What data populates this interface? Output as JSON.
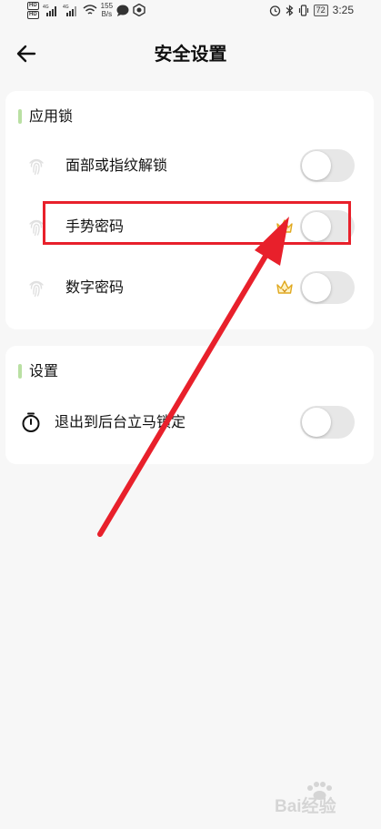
{
  "status_bar": {
    "hd_top": "HD",
    "hd_bottom": "HD",
    "net_type_1": "4G",
    "net_type_2": "4G",
    "speed_value": "155",
    "speed_unit": "B/s",
    "battery_level": "72",
    "time": "3:25",
    "icons": [
      "wifi-icon",
      "message-icon",
      "app-notification-icon",
      "alarm-icon",
      "bluetooth-icon",
      "vibrate-icon",
      "battery-icon"
    ]
  },
  "header": {
    "title": "安全设置",
    "back_icon": "arrow-left-icon"
  },
  "app_lock": {
    "title": "应用锁",
    "accent_color": "#b9e0a3",
    "items": [
      {
        "label": "面部或指纹解锁",
        "icon": "fingerprint-icon",
        "premium": false,
        "enabled": false
      },
      {
        "label": "手势密码",
        "icon": "fingerprint-icon",
        "premium": true,
        "enabled": false
      },
      {
        "label": "数字密码",
        "icon": "fingerprint-icon",
        "premium": true,
        "enabled": false
      }
    ]
  },
  "settings": {
    "title": "设置",
    "items": [
      {
        "label": "退出到后台立马锁定",
        "icon": "stopwatch-icon",
        "enabled": false
      }
    ]
  },
  "annotation": {
    "color": "#e8202b"
  },
  "watermark": {
    "text": "Bai经验"
  }
}
